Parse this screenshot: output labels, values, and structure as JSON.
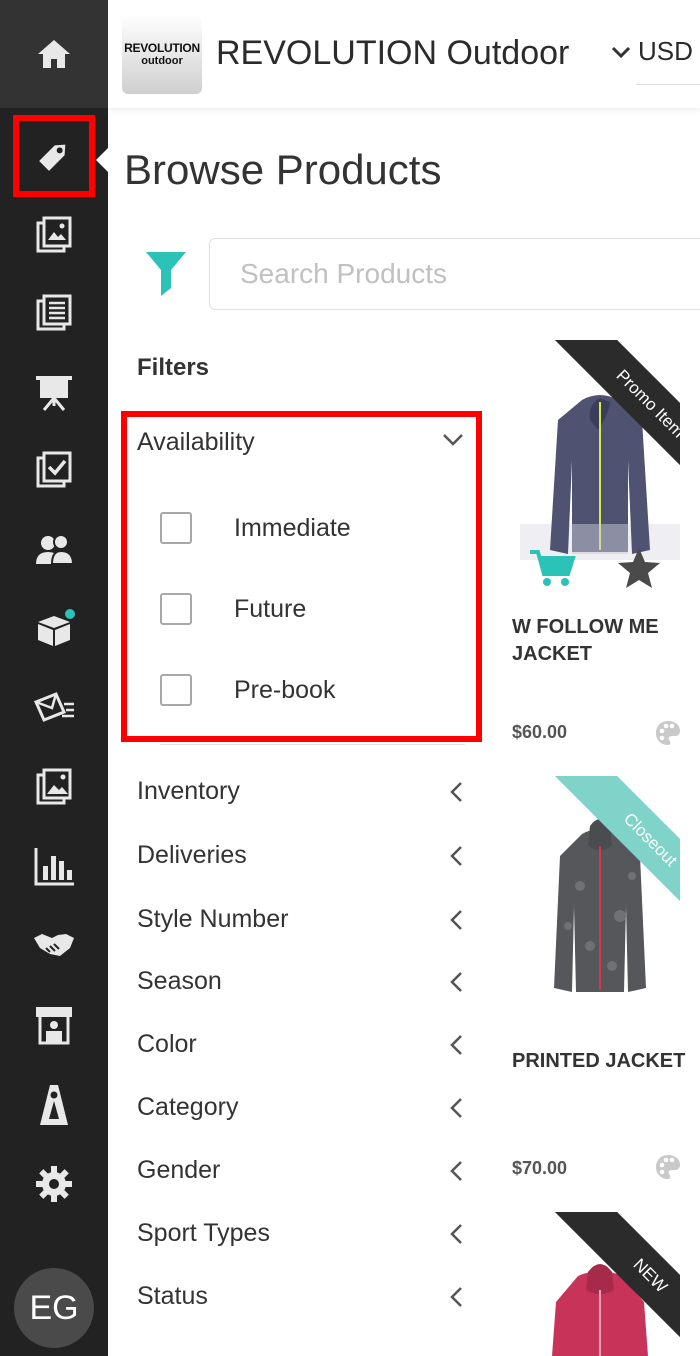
{
  "header": {
    "logo_line1": "REVOLUTION",
    "logo_line2": "outdoor",
    "brand_name": "REVOLUTION Outdoor",
    "currency": "USD"
  },
  "sidebar": {
    "items": [
      {
        "icon": "home-icon"
      },
      {
        "icon": "tag-icon",
        "active": true
      },
      {
        "icon": "catalog-icon"
      },
      {
        "icon": "list-icon"
      },
      {
        "icon": "presentation-icon"
      },
      {
        "icon": "checklist-icon"
      },
      {
        "icon": "users-icon"
      },
      {
        "icon": "box-icon",
        "notification": true
      },
      {
        "icon": "mail-icon"
      },
      {
        "icon": "images-icon"
      },
      {
        "icon": "chart-icon"
      },
      {
        "icon": "handshake-icon"
      },
      {
        "icon": "store-icon"
      },
      {
        "icon": "mannequin-icon"
      },
      {
        "icon": "gear-icon"
      }
    ],
    "avatar_initials": "EG"
  },
  "page": {
    "title": "Browse Products",
    "search_placeholder": "Search Products"
  },
  "filters": {
    "title": "Filters",
    "availability": {
      "label": "Availability",
      "options": [
        {
          "label": "Immediate",
          "checked": false
        },
        {
          "label": "Future",
          "checked": false
        },
        {
          "label": "Pre-book",
          "checked": false
        }
      ]
    },
    "groups": [
      "Inventory",
      "Deliveries",
      "Style Number",
      "Season",
      "Color",
      "Category",
      "Gender",
      "Sport Types",
      "Status"
    ]
  },
  "products": [
    {
      "name": "W FOLLOW ME JACKET",
      "price": "$60.00",
      "ribbon": "Promo Item",
      "ribbon_color": "#2b2b2b"
    },
    {
      "name": "PRINTED JACKET",
      "price": "$70.00",
      "ribbon": "Closeout",
      "ribbon_color": "#7fd3c9"
    },
    {
      "name": "",
      "price": "",
      "ribbon": "NEW",
      "ribbon_color": "#2b2b2b"
    }
  ],
  "colors": {
    "accent": "#2bc3b8",
    "highlight": "#ff0000",
    "sidebar_bg": "#222222"
  }
}
